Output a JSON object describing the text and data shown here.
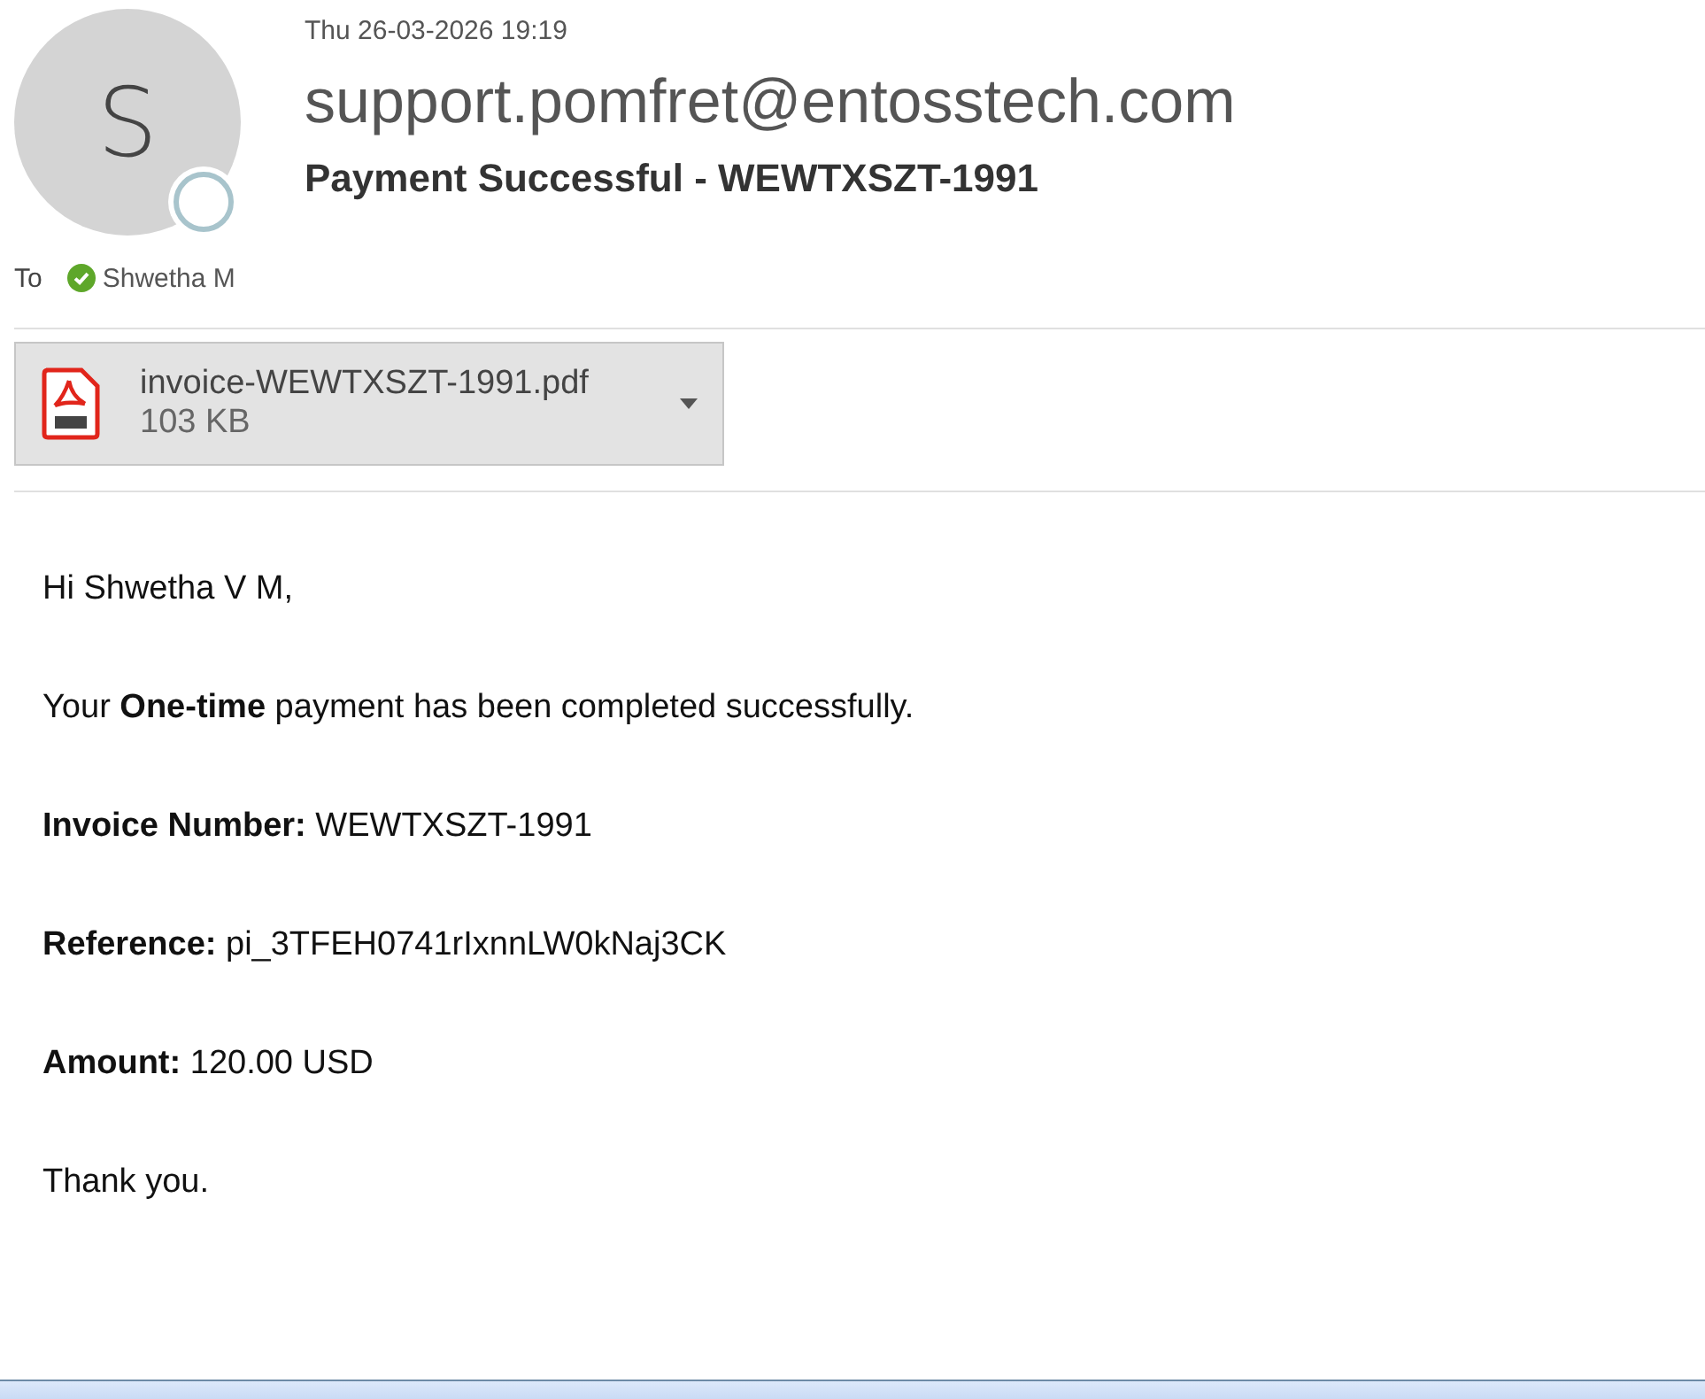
{
  "header": {
    "avatar_initial": "S",
    "date": "Thu 26-03-2026 19:19",
    "sender": "support.pomfret@entosstech.com",
    "subject": "Payment Successful - WEWTXSZT-1991",
    "to_label": "To",
    "recipients": [
      {
        "name": "Shwetha M",
        "verified": true
      }
    ]
  },
  "attachments": [
    {
      "name": "invoice-WEWTXSZT-1991.pdf",
      "size": "103 KB",
      "kind": "pdf"
    }
  ],
  "body": [
    "Hi Shwetha V M,",
    "Your **One-time** payment has been completed successfully.",
    "**Invoice Number:** WEWTXSZT-1991",
    "**Reference:** pi_3TFEH0741rIxnnLW0kNaj3CK",
    "**Amount:** 120.00 USD",
    "Thank you."
  ]
}
